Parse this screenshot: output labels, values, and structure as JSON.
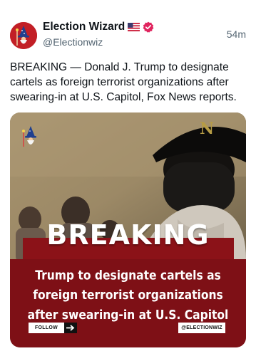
{
  "post": {
    "author_name": "Election Wizard",
    "author_flag": "us-flag-icon",
    "verified": true,
    "handle": "@Electionwiz",
    "time": "54m",
    "text": "BREAKING — Donald J. Trump to designate cartels as foreign terrorist organizations after swearing-in at U.S. Capitol, Fox News reports."
  },
  "media": {
    "banner_word": "BREAKING",
    "headline_lines": [
      "Trump to designate cartels as",
      "foreign terrorist organizations",
      "after swearing-in at U.S. Capitol"
    ],
    "follow_label": "FOLLOW",
    "footer_handle": "@ELECTIONWIZ"
  },
  "colors": {
    "accent_red": "#c21f26",
    "panel_red": "#7e1016",
    "verified_red": "#e0245e"
  }
}
